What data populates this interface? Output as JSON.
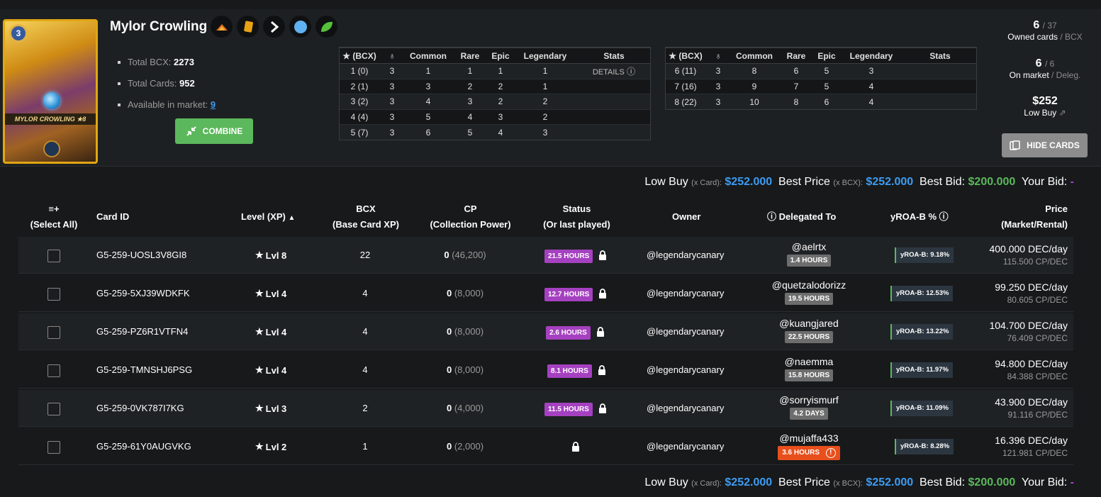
{
  "card": {
    "name": "Mylor Crowling",
    "art_level": "3",
    "art_name": "MYLOR CROWLING  ★8",
    "icons": [
      "fire-swords-icon",
      "card-stack-icon",
      "chevron-right-icon",
      "blue-circle-icon",
      "leaf-icon"
    ],
    "total_bcx_label": "Total BCX:",
    "total_bcx": "2273",
    "total_cards_label": "Total Cards:",
    "total_cards": "952",
    "available_label": "Available in market:",
    "available": "9",
    "combine_label": "COMBINE"
  },
  "level_table": {
    "headers": [
      "(BCX)",
      "",
      "Common",
      "Rare",
      "Epic",
      "Legendary",
      "Stats"
    ],
    "details_label": "DETAILS",
    "left_rows": [
      [
        "1 (0)",
        "3",
        "1",
        "1",
        "1",
        "1"
      ],
      [
        "2 (1)",
        "3",
        "3",
        "2",
        "2",
        "1"
      ],
      [
        "3 (2)",
        "3",
        "4",
        "3",
        "2",
        "2"
      ],
      [
        "4 (4)",
        "3",
        "5",
        "4",
        "3",
        "2"
      ],
      [
        "5 (7)",
        "3",
        "6",
        "5",
        "4",
        "3"
      ]
    ],
    "right_rows": [
      [
        "6 (11)",
        "3",
        "8",
        "6",
        "5",
        "3"
      ],
      [
        "7 (16)",
        "3",
        "9",
        "7",
        "5",
        "4"
      ],
      [
        "8 (22)",
        "3",
        "10",
        "8",
        "6",
        "4"
      ]
    ]
  },
  "stats": {
    "owned": "6",
    "owned_total": "/ 37",
    "owned_label": "Owned cards",
    "owned_sub": "/ BCX",
    "market": "6",
    "market_total": "/ 6",
    "market_label": "On market",
    "market_sub": "/ Deleg.",
    "low_buy": "$252",
    "low_buy_label": "Low Buy",
    "hide_cards": "HIDE CARDS"
  },
  "price_summary": {
    "low_buy_label": "Low Buy",
    "low_buy_sub": "(x Card):",
    "low_buy": "$252.000",
    "best_price_label": "Best Price",
    "best_price_sub": "(x BCX):",
    "best_price": "$252.000",
    "best_bid_label": "Best Bid:",
    "best_bid": "$200.000",
    "your_bid_label": "Your Bid:",
    "your_bid": "-"
  },
  "columns": {
    "select_all_top": "≡+",
    "select_all": "(Select All)",
    "card_id": "Card ID",
    "level": "Level (XP)",
    "bcx": "BCX",
    "bcx_sub": "(Base Card XP)",
    "cp": "CP",
    "cp_sub": "(Collection Power)",
    "status": "Status",
    "status_sub": "(Or last played)",
    "owner": "Owner",
    "delegated": "Delegated To",
    "yroa": "yROA-B %",
    "price": "Price",
    "price_sub": "(Market/Rental)"
  },
  "rows": [
    {
      "id": "G5-259-UOSL3V8GI8",
      "level": "Lvl 8",
      "bcx": "22",
      "cp": "0",
      "cp_sub": "(46,200)",
      "status": "21.5 HOURS",
      "owner": "@legendarycanary",
      "deleg": "@aelrtx",
      "deleg_time": "1.4 HOURS",
      "yroa": "yROA-B: 9.18%",
      "price": "400.000 DEC/day",
      "price_sub": "115.500 CP/DEC"
    },
    {
      "id": "G5-259-5XJ39WDKFK",
      "level": "Lvl 4",
      "bcx": "4",
      "cp": "0",
      "cp_sub": "(8,000)",
      "status": "12.7 HOURS",
      "owner": "@legendarycanary",
      "deleg": "@quetzalodorizz",
      "deleg_time": "19.5 HOURS",
      "yroa": "yROA-B: 12.53%",
      "price": "99.250 DEC/day",
      "price_sub": "80.605 CP/DEC"
    },
    {
      "id": "G5-259-PZ6R1VTFN4",
      "level": "Lvl 4",
      "bcx": "4",
      "cp": "0",
      "cp_sub": "(8,000)",
      "status": "2.6 HOURS",
      "owner": "@legendarycanary",
      "deleg": "@kuangjared",
      "deleg_time": "22.5 HOURS",
      "yroa": "yROA-B: 13.22%",
      "price": "104.700 DEC/day",
      "price_sub": "76.409 CP/DEC"
    },
    {
      "id": "G5-259-TMNSHJ6PSG",
      "level": "Lvl 4",
      "bcx": "4",
      "cp": "0",
      "cp_sub": "(8,000)",
      "status": "8.1 HOURS",
      "owner": "@legendarycanary",
      "deleg": "@naemma",
      "deleg_time": "15.8 HOURS",
      "yroa": "yROA-B: 11.97%",
      "price": "94.800 DEC/day",
      "price_sub": "84.388 CP/DEC"
    },
    {
      "id": "G5-259-0VK787I7KG",
      "level": "Lvl 3",
      "bcx": "2",
      "cp": "0",
      "cp_sub": "(4,000)",
      "status": "11.5 HOURS",
      "owner": "@legendarycanary",
      "deleg": "@sorryismurf",
      "deleg_time": "4.2 DAYS",
      "yroa": "yROA-B: 11.09%",
      "price": "43.900 DEC/day",
      "price_sub": "91.116 CP/DEC"
    },
    {
      "id": "G5-259-61Y0AUGVKG",
      "level": "Lvl 2",
      "bcx": "1",
      "cp": "0",
      "cp_sub": "(2,000)",
      "status": "",
      "owner": "@legendarycanary",
      "deleg": "@mujaffa433",
      "deleg_time": "3.6 HOURS",
      "yroa": "yROA-B: 8.28%",
      "price": "16.396 DEC/day",
      "price_sub": "121.981 CP/DEC"
    }
  ]
}
